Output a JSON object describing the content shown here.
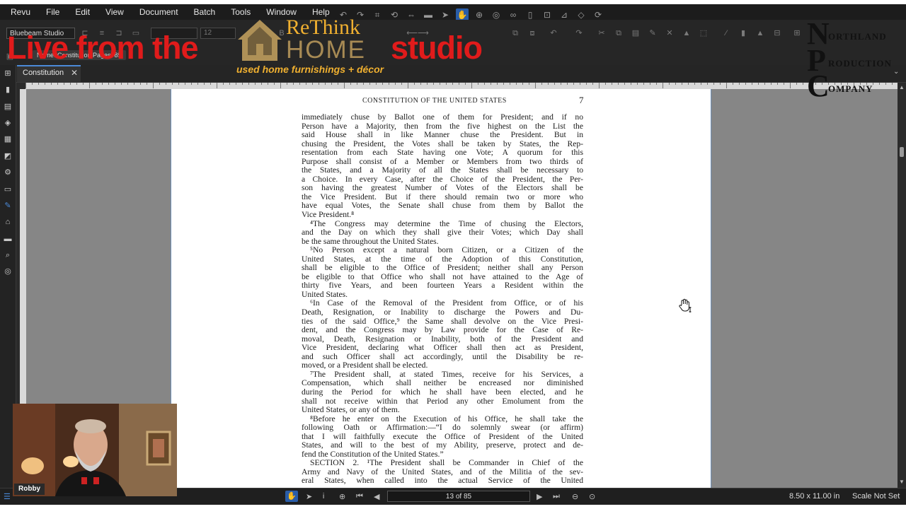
{
  "app": {
    "menu": [
      "Revu",
      "File",
      "Edit",
      "View",
      "Document",
      "Batch",
      "Tools",
      "Window",
      "Help"
    ],
    "profile": "Bluebeam Studio",
    "font_size": "12",
    "toolbar_chip": "Name: Constitution  Pages: 85"
  },
  "tabs": [
    {
      "label": "Constitution"
    }
  ],
  "document": {
    "running_head": "CONSTITUTION OF THE UNITED STATES",
    "page_number": "7",
    "lines": [
      {
        "t": "immediately chuse by Ballot one of them for President; and if no"
      },
      {
        "t": "Person have a Majority, then from the five highest on the List the"
      },
      {
        "t": "said House shall in like Manner chuse the President. But in"
      },
      {
        "t": "chusing the President, the Votes shall be taken by States, the Rep-"
      },
      {
        "t": "resentation from each State having one Vote; A quorum for this"
      },
      {
        "t": "Purpose shall consist of a Member or Members from two thirds of"
      },
      {
        "t": "the States, and a Majority of all the States shall be necessary to"
      },
      {
        "t": "a Choice. In every Case, after the Choice of the President, the Per-"
      },
      {
        "t": "son having the greatest Number of Votes of the Electors shall be"
      },
      {
        "t": "the Vice President. But if there should remain two or more who"
      },
      {
        "t": "have equal Votes, the Senate shall chuse from them by Ballot the"
      },
      {
        "t": "Vice President.⁸",
        "last": true
      },
      {
        "t": "⁴The Congress may determine the Time of chusing the Electors,",
        "indent": true
      },
      {
        "t": "and the Day on which they shall give their Votes; which Day shall"
      },
      {
        "t": "be the same throughout the United States.",
        "last": true
      },
      {
        "t": "⁵No Person except a natural born Citizen, or a Citizen of the",
        "indent": true
      },
      {
        "t": "United States, at the time of the Adoption of this Constitution,"
      },
      {
        "t": "shall be eligible to the Office of President; neither shall any Person"
      },
      {
        "t": "be eligible to that Office who shall not have attained to the Age of"
      },
      {
        "t": "thirty five Years, and been fourteen Years a Resident within the"
      },
      {
        "t": "United States.",
        "last": true
      },
      {
        "t": "⁶In Case of the Removal of the President from Office, or of his",
        "indent": true
      },
      {
        "t": "Death, Resignation, or Inability to discharge the Powers and Du-"
      },
      {
        "t": "ties of the said Office,⁹ the Same shall devolve on the Vice Presi-"
      },
      {
        "t": "dent, and the Congress may by Law provide for the Case of Re-"
      },
      {
        "t": "moval, Death, Resignation or Inability, both of the President and"
      },
      {
        "t": "Vice President, declaring what Officer shall then act as President,"
      },
      {
        "t": "and such Officer shall act accordingly, until the Disability be re-"
      },
      {
        "t": "moved, or a President shall be elected.",
        "last": true
      },
      {
        "t": "⁷The President shall, at stated Times, receive for his Services, a",
        "indent": true
      },
      {
        "t": "Compensation, which shall neither be encreased nor diminished"
      },
      {
        "t": "during the Period for which he shall have been elected, and he"
      },
      {
        "t": "shall not receive within that Period any other Emolument from the"
      },
      {
        "t": "United States, or any of them.",
        "last": true
      },
      {
        "t": "⁸Before he enter on the Execution of his Office, he shall take the",
        "indent": true
      },
      {
        "t": "following Oath or Affirmation:—“I do solemnly swear (or affirm)"
      },
      {
        "t": "that I will faithfully execute the Office of President of the United"
      },
      {
        "t": "States, and will to the best of my Ability, preserve, protect and de-"
      },
      {
        "t": "fend the Constitution of the United States.”",
        "last": true
      },
      {
        "t": "SECTION 2. ¹The President shall be Commander in Chief of the",
        "indent": true
      },
      {
        "t": "Army and Navy of the United States, and of the Militia of the sev-"
      },
      {
        "t": "eral States, when called into the actual Service of the United"
      }
    ]
  },
  "status": {
    "page_indicator": "13 of 85",
    "page_size": "8.50 x 11.00 in",
    "scale": "Scale Not Set"
  },
  "overlay": {
    "title_left": "Live from the",
    "title_right": "studio",
    "logo_top": "ReThink",
    "logo_bottom": "HOME",
    "tagline": "used home furnishings + décor",
    "npc_letters": [
      "N",
      "P",
      "C"
    ],
    "npc_words": [
      "ORTHLAND",
      "RODUCTION",
      "OMPANY"
    ],
    "presenter": "Robby"
  },
  "icons": {
    "cursor": "hand-cursor-icon",
    "close": "close-icon"
  }
}
